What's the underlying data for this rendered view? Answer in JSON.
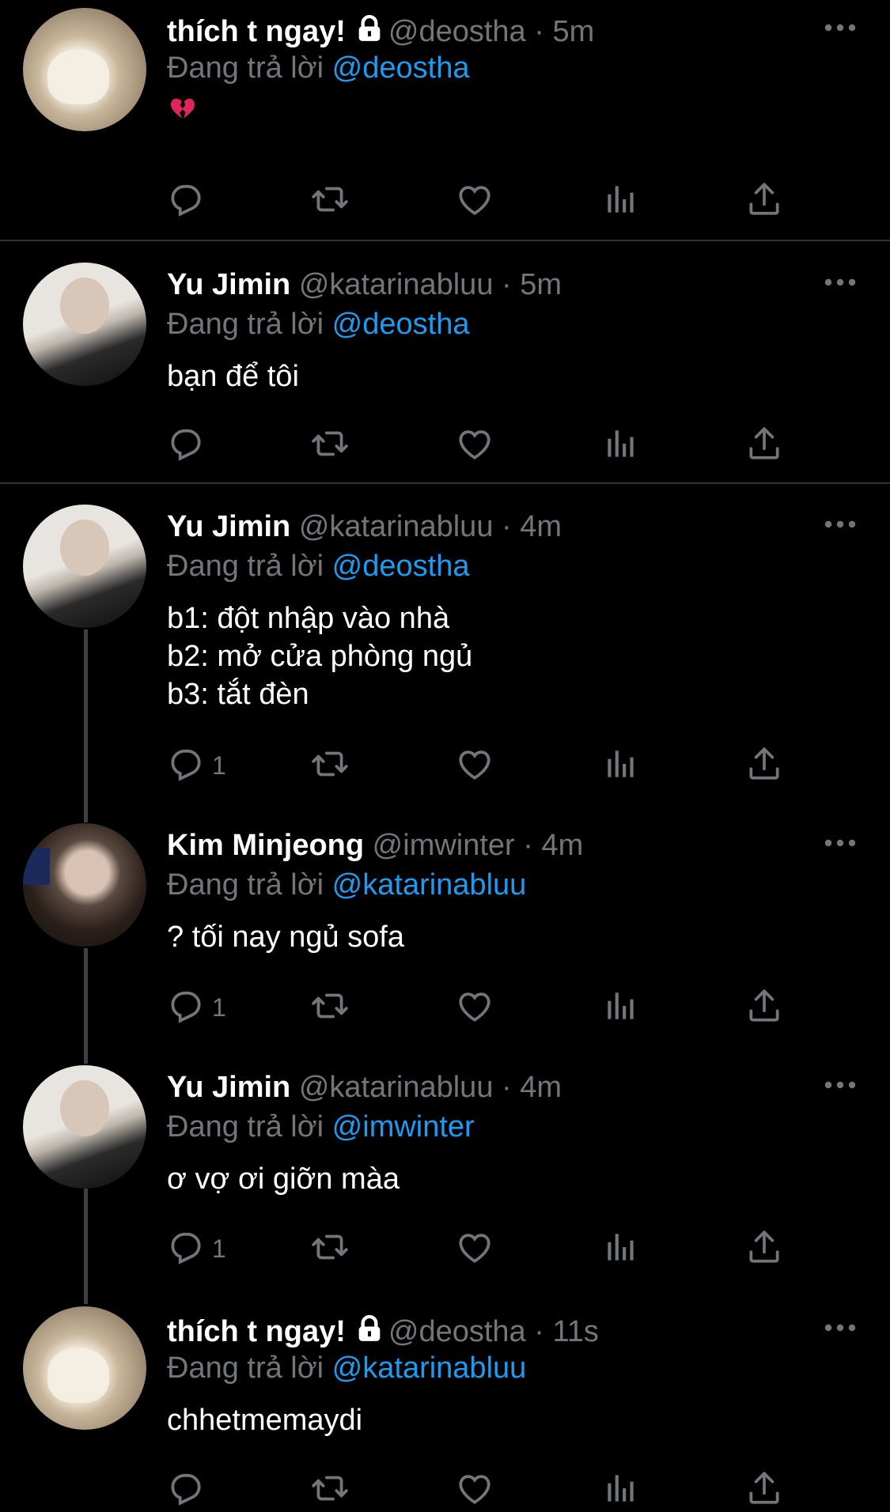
{
  "colors": {
    "background": "#000000",
    "text": "#e7e9ea",
    "secondary": "#71767b",
    "accent": "#1d9bf0",
    "divider": "#2f3336"
  },
  "reply_prefix": "Đang trả lời",
  "dot": "·",
  "tweets": [
    {
      "name": "thích t ngay!",
      "locked": true,
      "handle": "@deostha",
      "time": "5m",
      "reply_to": "@deostha",
      "body": "",
      "body_emoji": "broken-heart-icon",
      "reply_count": "",
      "avatar": "cat-avatar"
    },
    {
      "name": "Yu Jimin",
      "locked": false,
      "handle": "@katarinabluu",
      "time": "5m",
      "reply_to": "@deostha",
      "body": "bạn để tôi",
      "reply_count": "",
      "avatar": "jimin-avatar"
    },
    {
      "name": "Yu Jimin",
      "locked": false,
      "handle": "@katarinabluu",
      "time": "4m",
      "reply_to": "@deostha",
      "body": "b1: đột nhập vào nhà\nb2: mở cửa phòng ngủ\nb3: tắt đèn",
      "reply_count": "1",
      "avatar": "jimin-avatar"
    },
    {
      "name": "Kim Minjeong",
      "locked": false,
      "handle": "@imwinter",
      "time": "4m",
      "reply_to": "@katarinabluu",
      "body": "? tối nay ngủ sofa",
      "reply_count": "1",
      "avatar": "minjeong-avatar"
    },
    {
      "name": "Yu Jimin",
      "locked": false,
      "handle": "@katarinabluu",
      "time": "4m",
      "reply_to": "@imwinter",
      "body": "ơ vợ ơi giỡn màa",
      "reply_count": "1",
      "avatar": "jimin-avatar"
    },
    {
      "name": "thích t ngay!",
      "locked": true,
      "handle": "@deostha",
      "time": "11s",
      "reply_to": "@katarinabluu",
      "body": "chhetmemaydi",
      "reply_count": "",
      "avatar": "cat-avatar"
    }
  ]
}
